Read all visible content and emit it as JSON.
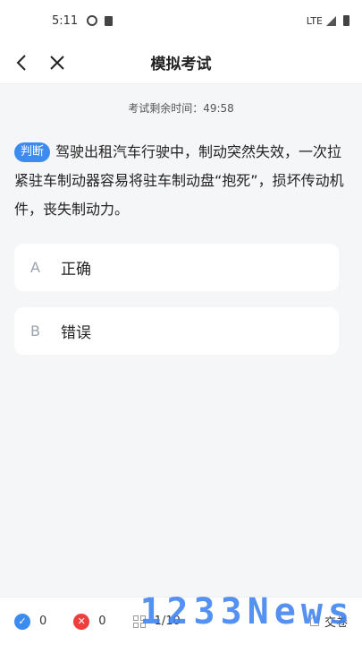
{
  "status_bar": {
    "time": "5:11",
    "network": "LTE"
  },
  "nav": {
    "title": "模拟考试"
  },
  "timer": {
    "label": "考试剩余时间：49:58"
  },
  "question": {
    "tag": "判断",
    "text": "驾驶出租汽车行驶中，制动突然失效，一次拉紧驻车制动器容易将驻车制动盘“抱死”，损坏传动机件，丧失制动力。"
  },
  "options": [
    {
      "letter": "A",
      "text": "正确"
    },
    {
      "letter": "B",
      "text": "错误"
    }
  ],
  "bottom_bar": {
    "correct_count": "0",
    "wrong_count": "0",
    "progress": "1/10",
    "submit_label": "交卷"
  },
  "watermark": "1233News",
  "colors": {
    "accent": "#3c8cf0",
    "wrong": "#ee3e3e"
  }
}
